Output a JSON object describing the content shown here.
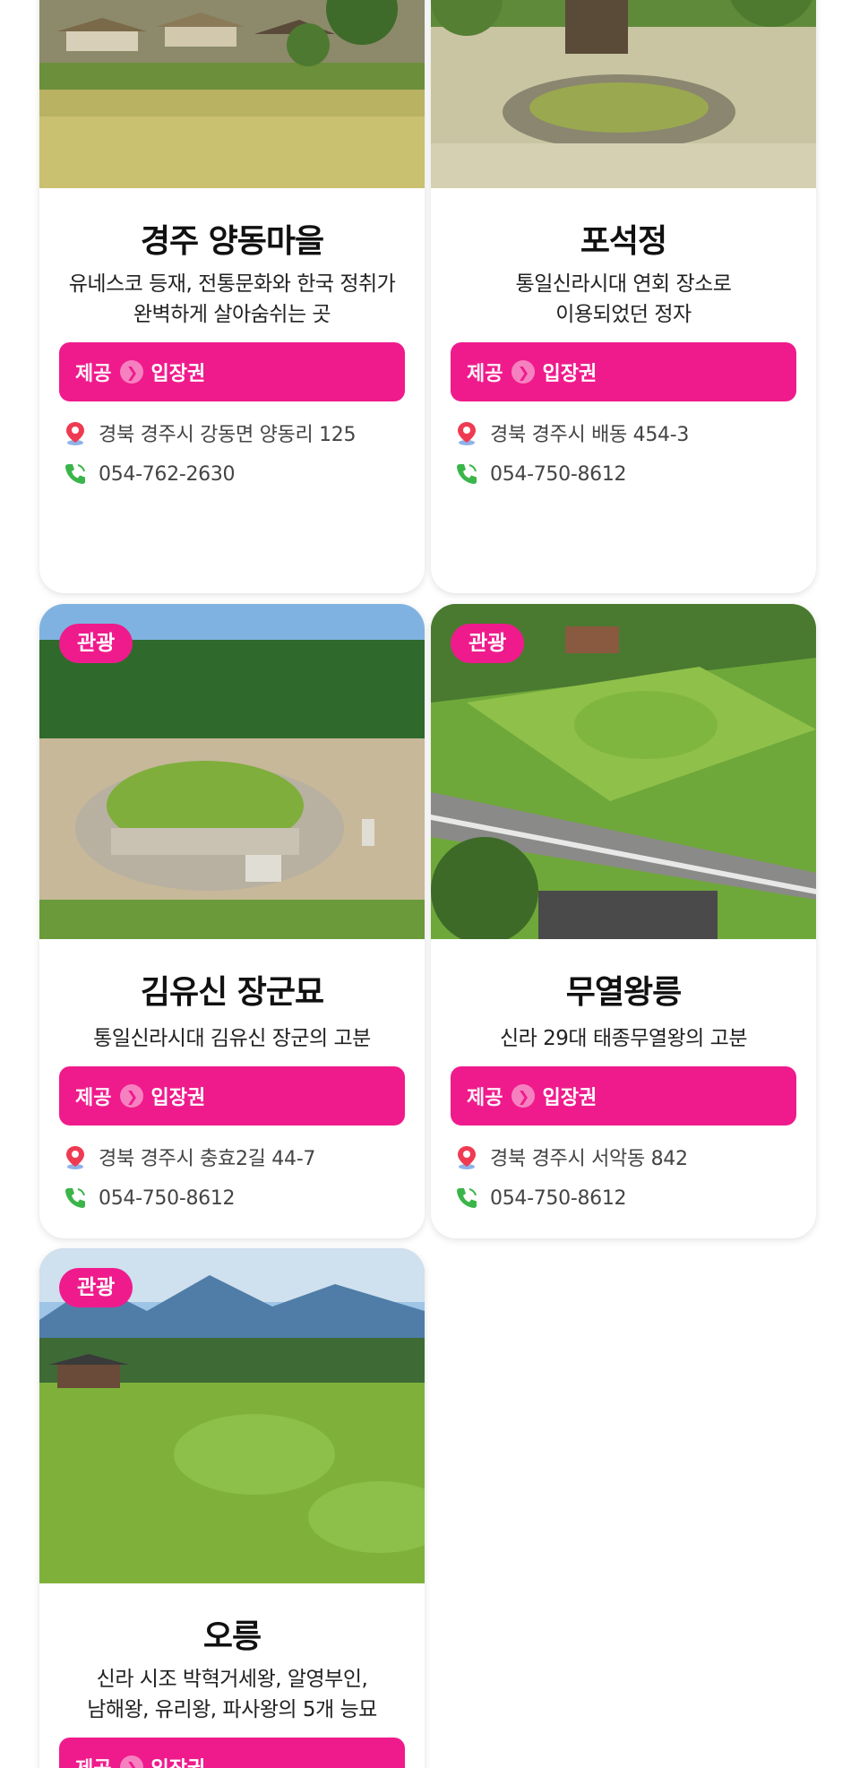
{
  "colors": {
    "accent": "#ef1b8c",
    "card_bg": "#ffffff",
    "text": "#111111",
    "subtext": "#444444"
  },
  "provide_label": "제공",
  "cards": [
    {
      "badge": "",
      "title": "경주 양동마을",
      "desc_lines": [
        "유네스코 등재, 전통문화와 한국 정취가",
        "완벽하게 살아숨쉬는 곳"
      ],
      "benefit": "입장권",
      "address": "경북 경주시 강동면 양동리 125",
      "phone": "054-762-2630"
    },
    {
      "badge": "",
      "title": "포석정",
      "desc_lines": [
        "통일신라시대 연회 장소로",
        "이용되었던 정자"
      ],
      "benefit": "입장권",
      "address": "경북 경주시 배동 454-3",
      "phone": "054-750-8612"
    },
    {
      "badge": "관광",
      "title": "김유신 장군묘",
      "desc_lines": [
        "통일신라시대 김유신 장군의 고분"
      ],
      "benefit": "입장권",
      "address": "경북 경주시 충효2길 44-7",
      "phone": "054-750-8612"
    },
    {
      "badge": "관광",
      "title": "무열왕릉",
      "desc_lines": [
        "신라 29대 태종무열왕의 고분"
      ],
      "benefit": "입장권",
      "address": "경북 경주시 서악동 842",
      "phone": "054-750-8612"
    },
    {
      "badge": "관광",
      "title": "오릉",
      "desc_lines": [
        "신라 시조 박혁거세왕, 알영부인,",
        "남해왕, 유리왕, 파사왕의 5개 능묘"
      ],
      "benefit": "입장권",
      "address": "",
      "phone": ""
    }
  ],
  "icons": {
    "location": "location-pin-icon",
    "phone": "phone-icon",
    "arrow": "chevron-right-icon"
  }
}
